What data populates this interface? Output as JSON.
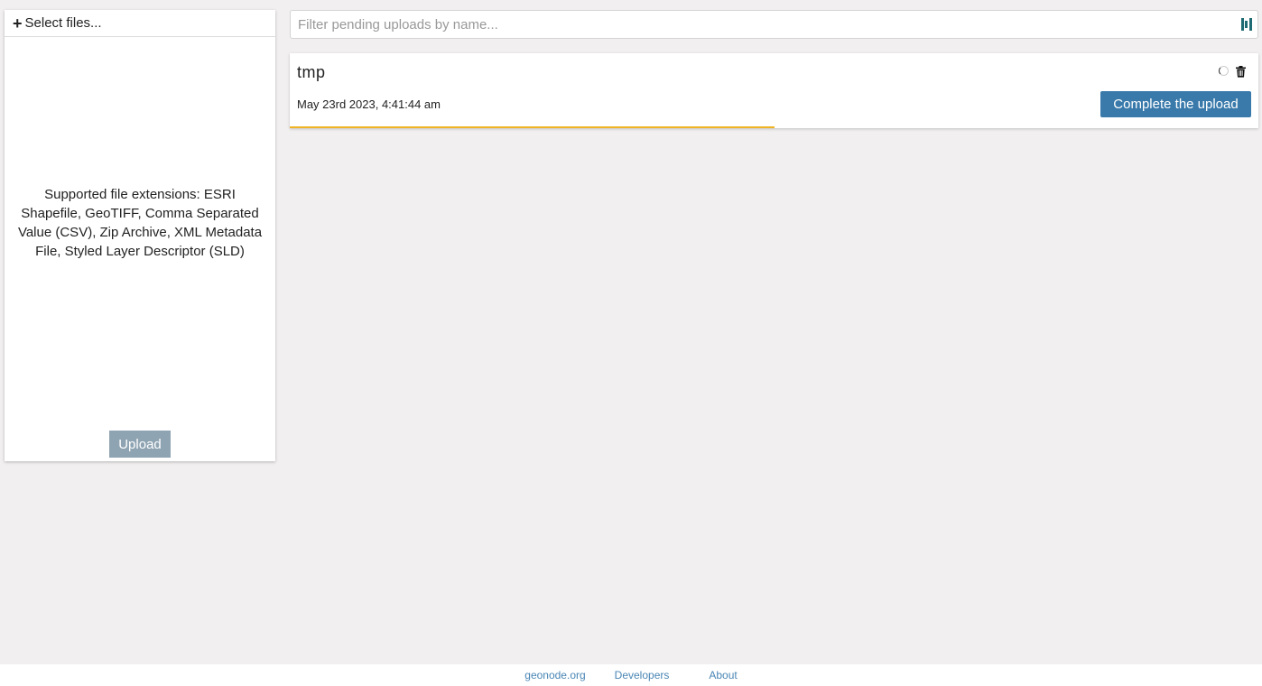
{
  "left_panel": {
    "select_files_label": "Select files...",
    "supported_text": "Supported file extensions: ESRI Shapefile, GeoTIFF, Comma Separated Value (CSV), Zip Archive, XML Metadata File, Styled Layer Descriptor (SLD)",
    "upload_label": "Upload"
  },
  "filter": {
    "placeholder": "Filter pending uploads by name...",
    "value": ""
  },
  "uploads": [
    {
      "name": "tmp",
      "date": "May 23rd 2023, 4:41:44 am",
      "action_label": "Complete the upload",
      "progress": 0.5
    }
  ],
  "footer": {
    "links": [
      "geonode.org",
      "Developers",
      "About"
    ]
  },
  "colors": {
    "accent": "#397aab",
    "progress": "#f0b323",
    "upload_disabled": "#8fa4b2",
    "link": "#4a86b5"
  }
}
